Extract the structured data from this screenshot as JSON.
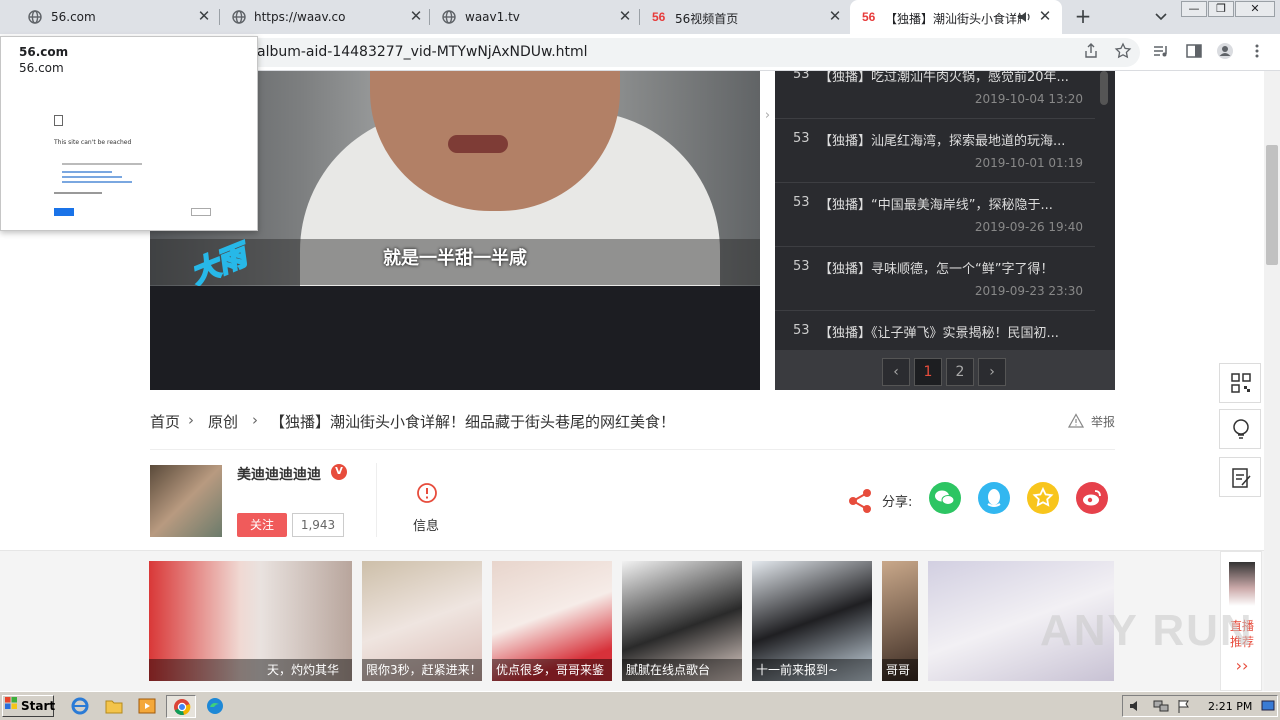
{
  "browser": {
    "tabs": [
      {
        "title": "56.com"
      },
      {
        "title": "https://waav.co"
      },
      {
        "title": "waav1.tv"
      },
      {
        "title": "56视频首页"
      },
      {
        "title": "【独播】潮汕街头小食详解"
      }
    ],
    "url": "album-aid-14483277_vid-MTYwNjAxNDUw.html",
    "logo_text": "56"
  },
  "popup": {
    "title": "56.com",
    "url": "56.com",
    "mini_heading": "This site can't be reached"
  },
  "player": {
    "subtitle": "就是一半甜一半咸",
    "overlay_label": "大雨"
  },
  "playlist": {
    "items": [
      {
        "num": "53",
        "title": "【独播】吃过潮汕牛肉火锅，感觉前20年...",
        "date": "2019-10-04 13:20"
      },
      {
        "num": "53",
        "title": "【独播】汕尾红海湾，探索最地道的玩海...",
        "date": "2019-10-01 01:19"
      },
      {
        "num": "53",
        "title": "【独播】“中国最美海岸线”，探秘隐于...",
        "date": "2019-09-26 19:40"
      },
      {
        "num": "53",
        "title": "【独播】寻味顺德，怎一个“鲜”字了得！",
        "date": "2019-09-23 23:30"
      },
      {
        "num": "53",
        "title": "【独播】《让子弹飞》实景揭秘！民国初...",
        "date": ""
      }
    ],
    "pager": {
      "prev": "‹",
      "pages": [
        "1",
        "2"
      ],
      "next": "›"
    }
  },
  "breadcrumb": {
    "home": "首页",
    "category": "原创",
    "title": "【独播】潮汕街头小食详解！细品藏于街头巷尾的网红美食！"
  },
  "report_label": "举报",
  "uploader": {
    "name": "美迪迪迪迪迪",
    "badge": "V",
    "follow_label": "关注",
    "followers": "1,943"
  },
  "info_label": "信息",
  "share": {
    "label": "分享:",
    "colors": {
      "wechat": "#2dc563",
      "qq": "#32b7f0",
      "qzone": "#f8c51c",
      "weibo": "#e6414b"
    }
  },
  "thumbnails": [
    {
      "caption": "天，灼灼其华"
    },
    {
      "caption": "限你3秒，赶紧进来！"
    },
    {
      "caption": "优点很多，哥哥来鉴"
    },
    {
      "caption": "腻腻在线点歌台"
    },
    {
      "caption": "十一前来报到~"
    },
    {
      "caption": "哥哥"
    },
    {
      "caption": ""
    }
  ],
  "live": {
    "label": "直播推荐",
    "arrow": "››"
  },
  "watermark": "ANY RUN",
  "taskbar": {
    "start": "Start",
    "time": "2:21 PM"
  }
}
